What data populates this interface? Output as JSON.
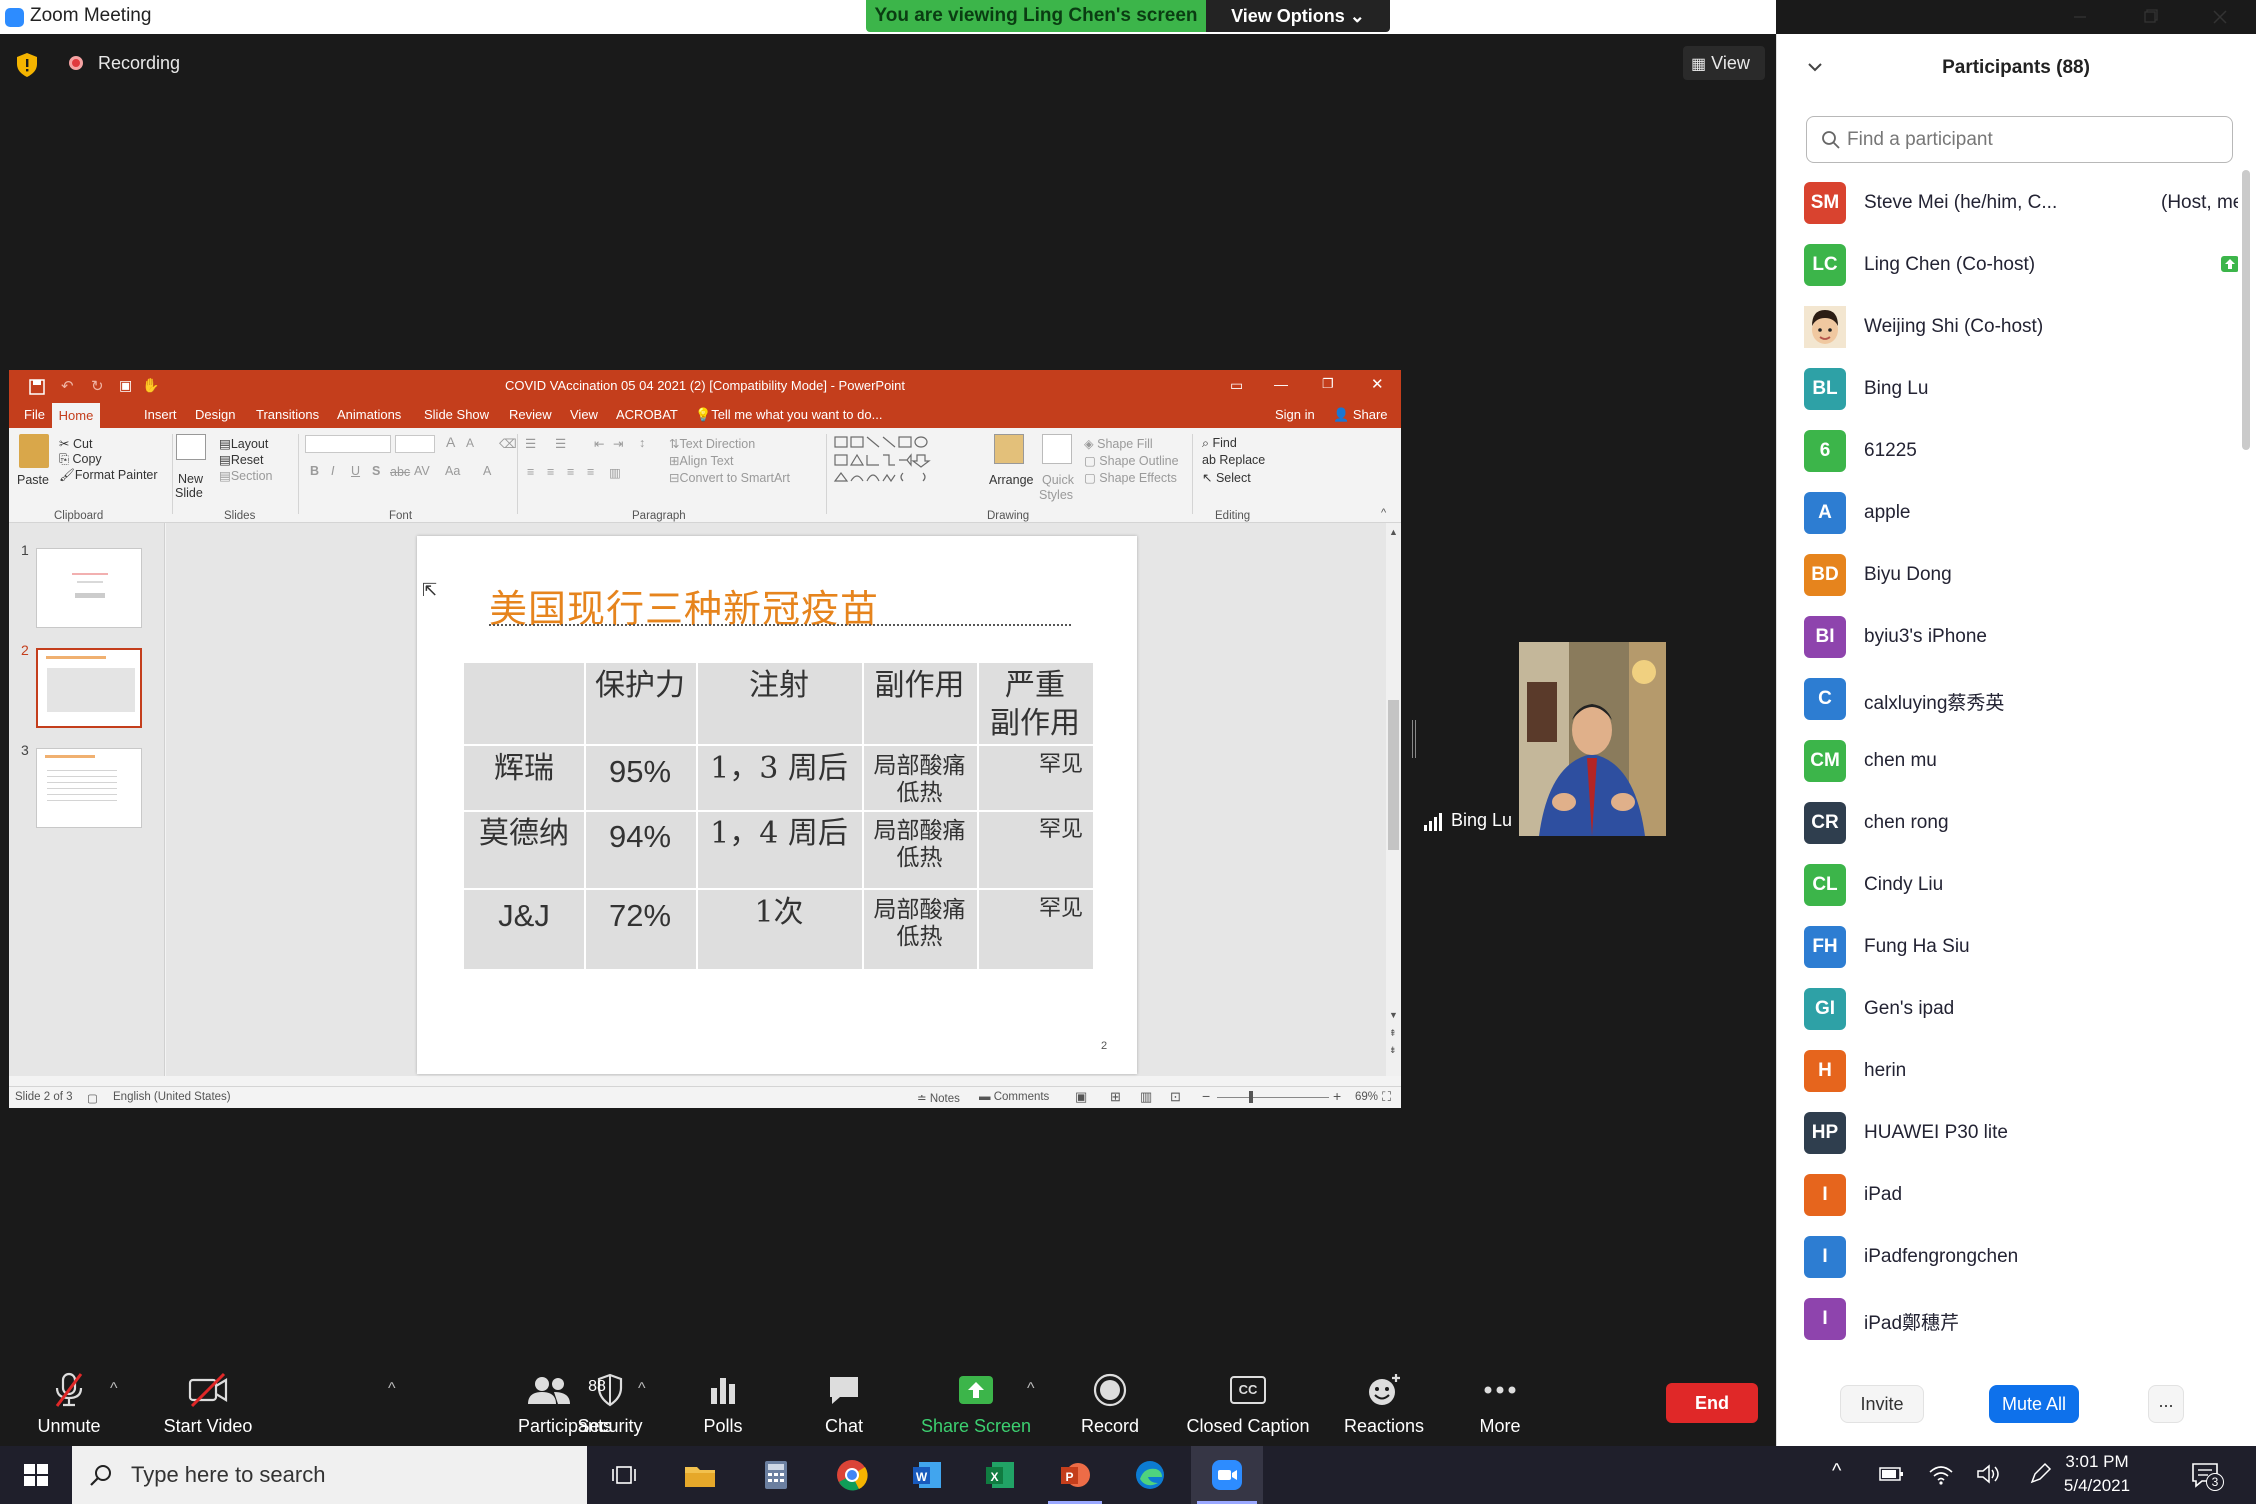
{
  "window": {
    "title": "Zoom Meeting"
  },
  "banner": {
    "viewing": "You are viewing Ling Chen's screen",
    "view_options": "View Options"
  },
  "meeting": {
    "recording": "Recording",
    "view": "View"
  },
  "ppt": {
    "title": "COVID VAccination 05 04 2021 (2) [Compatibility Mode] - PowerPoint",
    "tabs": [
      "File",
      "Home",
      "Insert",
      "Design",
      "Transitions",
      "Animations",
      "Slide Show",
      "Review",
      "View",
      "ACROBAT"
    ],
    "tell_me": "Tell me what you want to do...",
    "sign_in": "Sign in",
    "share": "Share",
    "ribbon": {
      "paste": "Paste",
      "cut": "Cut",
      "copy": "Copy",
      "format_painter": "Format Painter",
      "clipboard": "Clipboard",
      "new_slide_1": "New",
      "new_slide_2": "Slide",
      "layout": "Layout",
      "reset": "Reset",
      "section": "Section",
      "slides": "Slides",
      "font": "Font",
      "text_direction": "Text Direction",
      "align_text": "Align Text",
      "convert_smartart": "Convert to SmartArt",
      "paragraph": "Paragraph",
      "arrange": "Arrange",
      "quick_styles_1": "Quick",
      "quick_styles_2": "Styles",
      "shape_fill": "Shape Fill",
      "shape_outline": "Shape Outline",
      "shape_effects": "Shape Effects",
      "drawing": "Drawing",
      "find": "Find",
      "replace": "Replace",
      "select": "Select",
      "editing": "Editing"
    },
    "thumbnails": [
      "1",
      "2",
      "3"
    ],
    "status": {
      "slide": "Slide 2 of 3",
      "language": "English (United States)",
      "notes": "Notes",
      "comments": "Comments",
      "zoom": "69%"
    },
    "slide_number": "2"
  },
  "slide": {
    "title": "美国现行三种新冠疫苗",
    "headers": [
      "保护力",
      "注射",
      "副作用",
      "严重",
      "副作用"
    ],
    "rows": [
      {
        "name": "辉瑞",
        "efficacy": "95%",
        "doses": "1，3 周后",
        "side1": "局部酸痛",
        "side2": "低热",
        "severe": "罕见"
      },
      {
        "name": "莫德纳",
        "efficacy": "94%",
        "doses": "1，4 周后",
        "side1": "局部酸痛",
        "side2": "低热",
        "severe": "罕见"
      },
      {
        "name": "J&J",
        "efficacy": "72%",
        "doses": "1次",
        "side1": "局部酸痛",
        "side2": "低热",
        "severe": "罕见"
      }
    ]
  },
  "video": {
    "name": "Bing Lu"
  },
  "participants": {
    "title": "Participants (88)",
    "search_placeholder": "Find a participant",
    "list": [
      {
        "initials": "SM",
        "name": "Steve Mei (he/him, C...",
        "role": "(Host, me)",
        "color": "#d9432f",
        "mic": "muted",
        "video": "off"
      },
      {
        "initials": "LC",
        "name": "Ling Chen (Co-host)",
        "color": "#3cb54a",
        "mic": "muted",
        "video": "on",
        "sharing": true,
        "recording": true
      },
      {
        "initials": "",
        "name": "Weijing Shi (Co-host)",
        "color": "#c9a27c",
        "mic": "muted",
        "video": "on",
        "photo": true
      },
      {
        "initials": "BL",
        "name": "Bing Lu",
        "color": "#2ea1a6",
        "mic": "on",
        "video": "on"
      },
      {
        "initials": "6",
        "name": "61225",
        "color": "#3cb54a",
        "mic": "muted",
        "video": "off"
      },
      {
        "initials": "A",
        "name": "apple",
        "color": "#2d7dd2",
        "mic": "muted",
        "video": "off"
      },
      {
        "initials": "BD",
        "name": "Biyu Dong",
        "color": "#e6841d",
        "mic": "muted",
        "video": "on"
      },
      {
        "initials": "BI",
        "name": "byiu3's iPhone",
        "color": "#8e44ad",
        "mic": "muted",
        "video": "off"
      },
      {
        "initials": "C",
        "name": "calxluying蔡秀英",
        "color": "#2d7dd2",
        "mic": "muted",
        "video": "off"
      },
      {
        "initials": "CM",
        "name": "chen mu",
        "color": "#3cb54a",
        "mic": "muted",
        "video": "off"
      },
      {
        "initials": "CR",
        "name": "chen rong",
        "color": "#2f3e4e",
        "mic": "muted",
        "video": "off"
      },
      {
        "initials": "CL",
        "name": "Cindy Liu",
        "color": "#3cb54a",
        "mic": "muted",
        "video": "off"
      },
      {
        "initials": "FH",
        "name": "Fung Ha Siu",
        "color": "#2d7dd2",
        "mic": "muted",
        "video": "off"
      },
      {
        "initials": "GI",
        "name": "Gen's ipad",
        "color": "#2ea1a6",
        "mic": "muted",
        "video": "on"
      },
      {
        "initials": "H",
        "name": "herin",
        "color": "#e6651d",
        "mic": "muted",
        "video": "off"
      },
      {
        "initials": "HP",
        "name": "HUAWEI P30 lite",
        "color": "#2f3e4e",
        "mic": "muted",
        "video": "on"
      },
      {
        "initials": "I",
        "name": "iPad",
        "color": "#e6651d",
        "mic": "muted",
        "video": "off"
      },
      {
        "initials": "I",
        "name": "iPadfengrongchen",
        "color": "#2d7dd2",
        "mic": "muted",
        "video": "off"
      },
      {
        "initials": "I",
        "name": "iPad鄭穗芹",
        "color": "#8e44ad",
        "mic": "muted",
        "video": "on"
      }
    ],
    "invite": "Invite",
    "mute_all": "Mute All",
    "more": "..."
  },
  "controls": {
    "unmute": "Unmute",
    "start_video": "Start Video",
    "security": "Security",
    "participants": "Participants",
    "participants_count": "88",
    "polls": "Polls",
    "chat": "Chat",
    "share_screen": "Share Screen",
    "record": "Record",
    "closed_caption": "Closed Caption",
    "cc_icon": "CC",
    "reactions": "Reactions",
    "more": "More",
    "end": "End"
  },
  "taskbar": {
    "search_placeholder": "Type here to search",
    "time": "3:01 PM",
    "date": "5/4/2021",
    "notifications": "3"
  },
  "colors": {
    "zoom_blue": "#2d8cff",
    "share_green": "#3cb54a",
    "ppt_orange": "#c43e1c",
    "end_red": "#e02828",
    "mute_red": "#e02828"
  }
}
